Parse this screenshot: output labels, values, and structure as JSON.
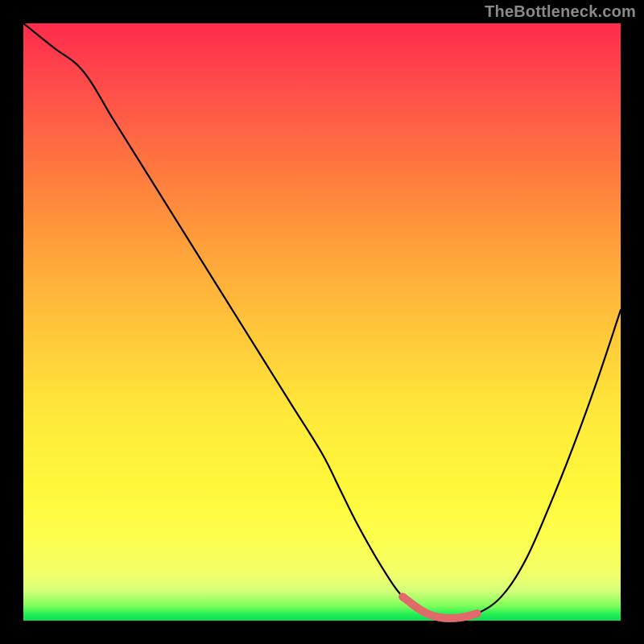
{
  "watermark": "TheBottleneck.com",
  "colors": {
    "background": "#000000",
    "gradient_top": "#ff2b4b",
    "gradient_bottom": "#0fdc50",
    "curve": "#000000",
    "highlight": "#e06969",
    "watermark": "#8a8a8a"
  },
  "chart_data": {
    "type": "line",
    "title": "",
    "xlabel": "",
    "ylabel": "",
    "xlim": [
      0,
      100
    ],
    "ylim": [
      0,
      100
    ],
    "grid": false,
    "series": [
      {
        "name": "bottleneck-curve",
        "x": [
          0,
          5,
          10,
          15,
          20,
          25,
          30,
          35,
          40,
          45,
          50,
          53,
          56,
          60,
          63.5,
          67,
          70,
          73,
          76,
          80,
          84,
          88,
          92,
          96,
          100
        ],
        "values": [
          100,
          96,
          92,
          84,
          76,
          68,
          60,
          52,
          44,
          36,
          28,
          22,
          16,
          9,
          4,
          1.5,
          0.5,
          0.5,
          1.2,
          4,
          10,
          19,
          29,
          40,
          52
        ]
      }
    ],
    "highlight_segment": {
      "series": "bottleneck-curve",
      "x_start": 63.5,
      "x_end": 76,
      "note": "thick segment near minimum"
    }
  }
}
